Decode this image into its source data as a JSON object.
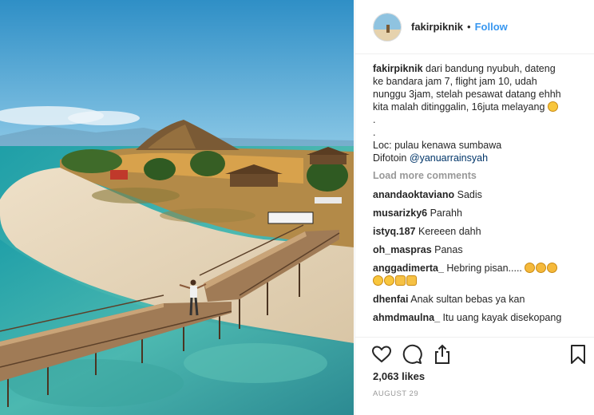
{
  "post": {
    "username": "fakirpiknik",
    "separator": "•",
    "follow_label": "Follow"
  },
  "caption": {
    "username": "fakirpiknik",
    "line1": "dari bandung nyubuh, dateng",
    "line2": "ke bandara jam 7, flight jam 10, udah",
    "line3": "nunggu 3jam, stelah pesawat datang ehhh",
    "line4": "kita malah ditinggalin, 16juta melayang",
    "dot1": ".",
    "dot2": ".",
    "loc": "Loc: pulau kenawa sumbawa",
    "photo_by": "Difotoin",
    "mention": "@yanuarrainsyah"
  },
  "load_more_label": "Load more comments",
  "comments": [
    {
      "user": "anandaoktaviano",
      "text": "Sadis"
    },
    {
      "user": "musarizky6",
      "text": "Parahh"
    },
    {
      "user": "istyq.187",
      "text": "Kereeen dahh"
    },
    {
      "user": "oh_maspras",
      "text": "Panas"
    },
    {
      "user": "anggadimerta_",
      "text": "Hebring pisan....."
    },
    {
      "user": "dhenfai",
      "text": "Anak sultan bebas ya kan"
    },
    {
      "user": "ahmdmaulna_",
      "text": "Itu uang kayak disekopang"
    }
  ],
  "icons": [
    "heart-icon",
    "comment-icon",
    "share-icon",
    "bookmark-icon"
  ],
  "likes_label": "2,063 likes",
  "date_label": "AUGUST 29",
  "colors": {
    "accent": "#3897f0",
    "mention": "#003569",
    "muted": "#999999",
    "text": "#262626"
  }
}
